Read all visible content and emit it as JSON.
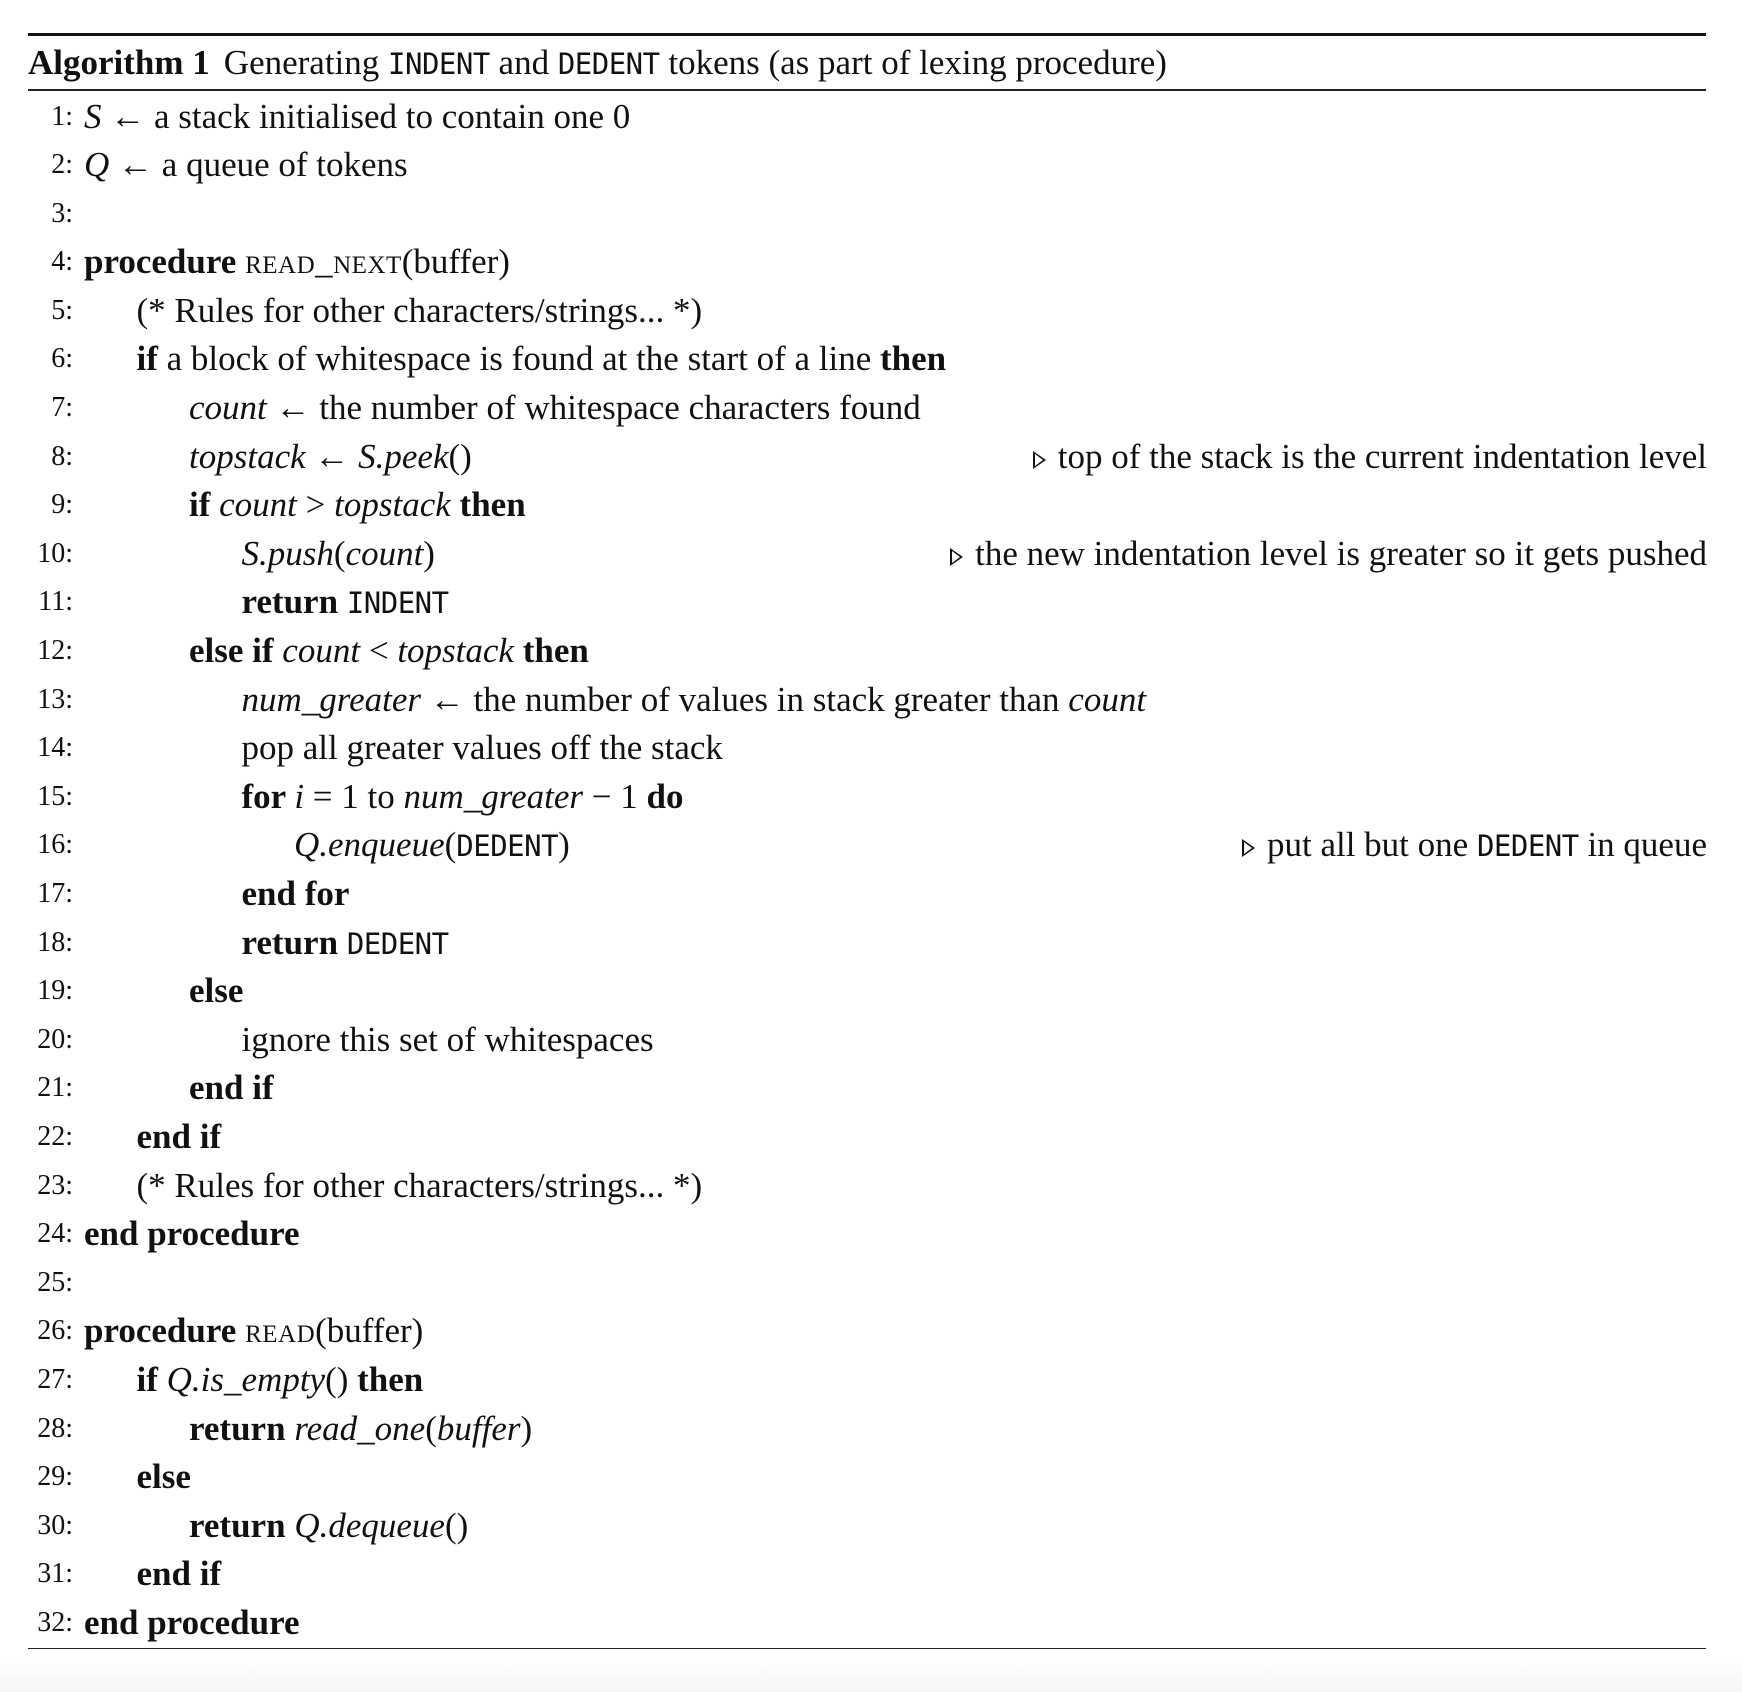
{
  "algorithm": {
    "caption": {
      "label": "Algorithm 1",
      "segments": [
        {
          "t": "text",
          "v": "Generating "
        },
        {
          "t": "mono",
          "v": "INDENT"
        },
        {
          "t": "text",
          "v": " and "
        },
        {
          "t": "mono",
          "v": "DEDENT"
        },
        {
          "t": "text",
          "v": " tokens (as part of lexing procedure)"
        }
      ]
    },
    "lines": [
      {
        "n": "1:",
        "indent": 0,
        "seg": [
          {
            "t": "math",
            "v": "S"
          },
          {
            "t": "text",
            "v": " ← a stack initialised to contain one 0"
          }
        ]
      },
      {
        "n": "2:",
        "indent": 0,
        "seg": [
          {
            "t": "math",
            "v": "Q"
          },
          {
            "t": "text",
            "v": " ← a queue of tokens"
          }
        ]
      },
      {
        "n": "3:",
        "indent": 0,
        "seg": []
      },
      {
        "n": "4:",
        "indent": 0,
        "seg": [
          {
            "t": "kw",
            "v": "procedure "
          },
          {
            "t": "sc",
            "v": "read_next"
          },
          {
            "t": "text",
            "v": "(buffer)"
          }
        ]
      },
      {
        "n": "5:",
        "indent": 1,
        "seg": [
          {
            "t": "text",
            "v": "(* Rules for other characters/strings... *)"
          }
        ]
      },
      {
        "n": "6:",
        "indent": 1,
        "seg": [
          {
            "t": "kw",
            "v": "if "
          },
          {
            "t": "text",
            "v": "a block of whitespace is found at the start of a line "
          },
          {
            "t": "kw",
            "v": "then"
          }
        ]
      },
      {
        "n": "7:",
        "indent": 2,
        "seg": [
          {
            "t": "math",
            "v": "count"
          },
          {
            "t": "text",
            "v": " ← the number of whitespace characters found"
          }
        ]
      },
      {
        "n": "8:",
        "indent": 2,
        "seg": [
          {
            "t": "math",
            "v": "topstack"
          },
          {
            "t": "text",
            "v": " ← "
          },
          {
            "t": "math",
            "v": "S.peek"
          },
          {
            "t": "text",
            "v": "()"
          }
        ],
        "comment": "top of the stack is the current indentation level"
      },
      {
        "n": "9:",
        "indent": 2,
        "seg": [
          {
            "t": "kw",
            "v": "if "
          },
          {
            "t": "math",
            "v": "count"
          },
          {
            "t": "text",
            "v": " > "
          },
          {
            "t": "math",
            "v": "topstack"
          },
          {
            "t": "kw",
            "v": " then"
          }
        ]
      },
      {
        "n": "10:",
        "indent": 3,
        "seg": [
          {
            "t": "math",
            "v": "S.push"
          },
          {
            "t": "text",
            "v": "("
          },
          {
            "t": "math",
            "v": "count"
          },
          {
            "t": "text",
            "v": ")"
          }
        ],
        "comment": "the new indentation level is greater so it gets pushed"
      },
      {
        "n": "11:",
        "indent": 3,
        "seg": [
          {
            "t": "kw",
            "v": "return "
          },
          {
            "t": "mono",
            "v": "INDENT"
          }
        ]
      },
      {
        "n": "12:",
        "indent": 2,
        "seg": [
          {
            "t": "kw",
            "v": "else if "
          },
          {
            "t": "math",
            "v": "count"
          },
          {
            "t": "text",
            "v": " < "
          },
          {
            "t": "math",
            "v": "topstack"
          },
          {
            "t": "kw",
            "v": " then"
          }
        ]
      },
      {
        "n": "13:",
        "indent": 3,
        "seg": [
          {
            "t": "math",
            "v": "num_greater"
          },
          {
            "t": "text",
            "v": " ← the number of values in stack greater than "
          },
          {
            "t": "math",
            "v": "count"
          }
        ]
      },
      {
        "n": "14:",
        "indent": 3,
        "seg": [
          {
            "t": "text",
            "v": "pop all greater values off the stack"
          }
        ]
      },
      {
        "n": "15:",
        "indent": 3,
        "seg": [
          {
            "t": "kw",
            "v": "for "
          },
          {
            "t": "math",
            "v": "i"
          },
          {
            "t": "text",
            "v": " = 1 to "
          },
          {
            "t": "math",
            "v": "num_greater"
          },
          {
            "t": "text",
            "v": " − 1 "
          },
          {
            "t": "kw",
            "v": "do"
          }
        ]
      },
      {
        "n": "16:",
        "indent": 4,
        "seg": [
          {
            "t": "math",
            "v": "Q.enqueue"
          },
          {
            "t": "text",
            "v": "("
          },
          {
            "t": "mono",
            "v": "DEDENT"
          },
          {
            "t": "text",
            "v": ")"
          }
        ],
        "comment_seg": [
          {
            "t": "text",
            "v": "put all but one "
          },
          {
            "t": "mono",
            "v": "DEDENT"
          },
          {
            "t": "text",
            "v": " in queue"
          }
        ]
      },
      {
        "n": "17:",
        "indent": 3,
        "seg": [
          {
            "t": "kw",
            "v": "end for"
          }
        ]
      },
      {
        "n": "18:",
        "indent": 3,
        "seg": [
          {
            "t": "kw",
            "v": "return "
          },
          {
            "t": "mono",
            "v": "DEDENT"
          }
        ]
      },
      {
        "n": "19:",
        "indent": 2,
        "seg": [
          {
            "t": "kw",
            "v": "else"
          }
        ]
      },
      {
        "n": "20:",
        "indent": 3,
        "seg": [
          {
            "t": "text",
            "v": "ignore this set of whitespaces"
          }
        ]
      },
      {
        "n": "21:",
        "indent": 2,
        "seg": [
          {
            "t": "kw",
            "v": "end if"
          }
        ]
      },
      {
        "n": "22:",
        "indent": 1,
        "seg": [
          {
            "t": "kw",
            "v": "end if"
          }
        ]
      },
      {
        "n": "23:",
        "indent": 1,
        "seg": [
          {
            "t": "text",
            "v": "(* Rules for other characters/strings... *)"
          }
        ]
      },
      {
        "n": "24:",
        "indent": 0,
        "seg": [
          {
            "t": "kw",
            "v": "end procedure"
          }
        ]
      },
      {
        "n": "25:",
        "indent": 0,
        "seg": []
      },
      {
        "n": "26:",
        "indent": 0,
        "seg": [
          {
            "t": "kw",
            "v": "procedure "
          },
          {
            "t": "sc",
            "v": "read"
          },
          {
            "t": "text",
            "v": "(buffer)"
          }
        ]
      },
      {
        "n": "27:",
        "indent": 1,
        "seg": [
          {
            "t": "kw",
            "v": "if "
          },
          {
            "t": "math",
            "v": "Q.is_empty"
          },
          {
            "t": "text",
            "v": "() "
          },
          {
            "t": "kw",
            "v": "then"
          }
        ]
      },
      {
        "n": "28:",
        "indent": 2,
        "seg": [
          {
            "t": "kw",
            "v": "return "
          },
          {
            "t": "math",
            "v": "read_one"
          },
          {
            "t": "text",
            "v": "("
          },
          {
            "t": "math",
            "v": "buffer"
          },
          {
            "t": "text",
            "v": ")"
          }
        ]
      },
      {
        "n": "29:",
        "indent": 1,
        "seg": [
          {
            "t": "kw",
            "v": "else"
          }
        ]
      },
      {
        "n": "30:",
        "indent": 2,
        "seg": [
          {
            "t": "kw",
            "v": "return "
          },
          {
            "t": "math",
            "v": "Q.dequeue"
          },
          {
            "t": "text",
            "v": "()"
          }
        ]
      },
      {
        "n": "31:",
        "indent": 1,
        "seg": [
          {
            "t": "kw",
            "v": "end if"
          }
        ]
      },
      {
        "n": "32:",
        "indent": 0,
        "seg": [
          {
            "t": "kw",
            "v": "end procedure"
          }
        ]
      }
    ]
  }
}
